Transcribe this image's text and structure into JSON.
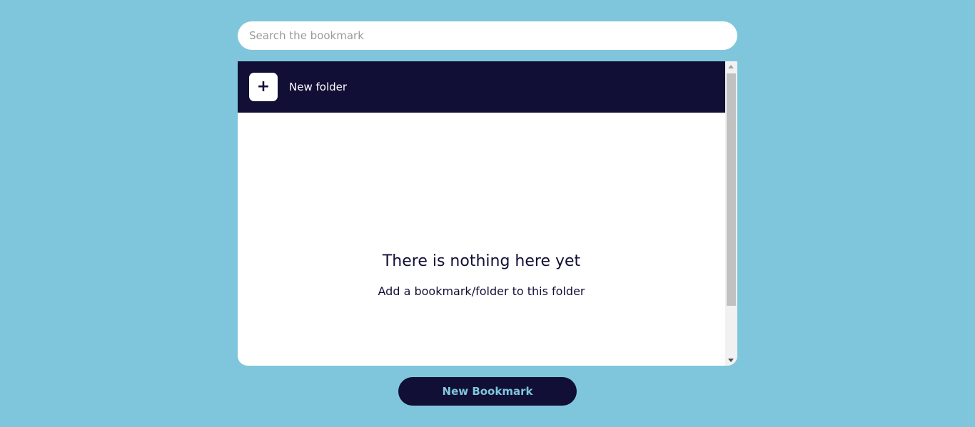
{
  "search": {
    "placeholder": "Search the bookmark",
    "value": ""
  },
  "folder_bar": {
    "add_icon": "+",
    "label": "New folder"
  },
  "empty_state": {
    "title": "There is nothing here yet",
    "subtitle": "Add a bookmark/folder to this folder"
  },
  "footer": {
    "new_bookmark_label": "New Bookmark"
  },
  "colors": {
    "background": "#7fc6dc",
    "dark": "#110f35",
    "white": "#ffffff"
  },
  "icons": {
    "plus": "plus-icon",
    "scroll_up": "scroll-up-arrow-icon",
    "scroll_down": "scroll-down-arrow-icon"
  }
}
